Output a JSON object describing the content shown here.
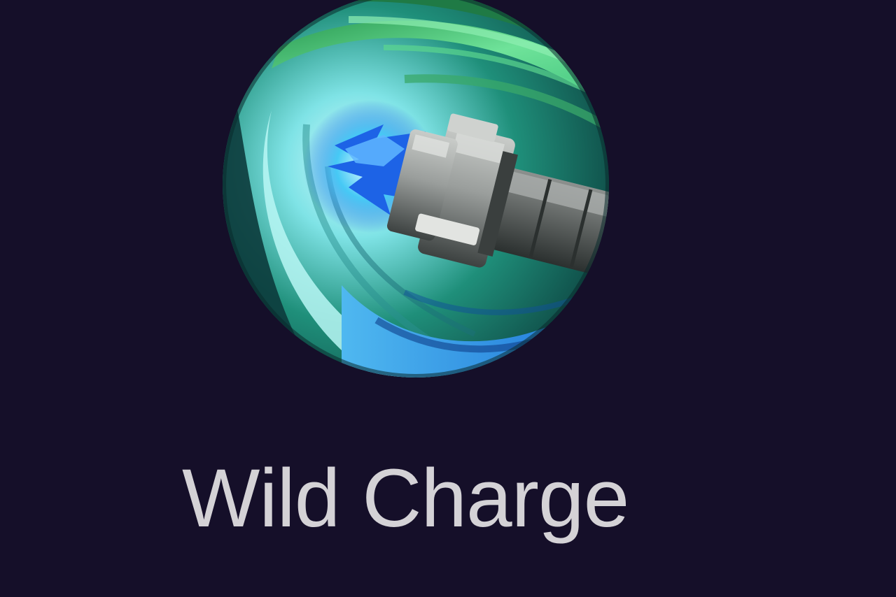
{
  "skill": {
    "name": "Wild Charge",
    "icon": "drill-charge-icon"
  },
  "colors": {
    "background": "#150f29",
    "label": "#d4d2d6",
    "swirl_green": "#4fd18a",
    "swirl_cyan": "#9ff2ec",
    "swirl_blue": "#2f8fe0",
    "drill_gray": "#9a9e9c"
  }
}
